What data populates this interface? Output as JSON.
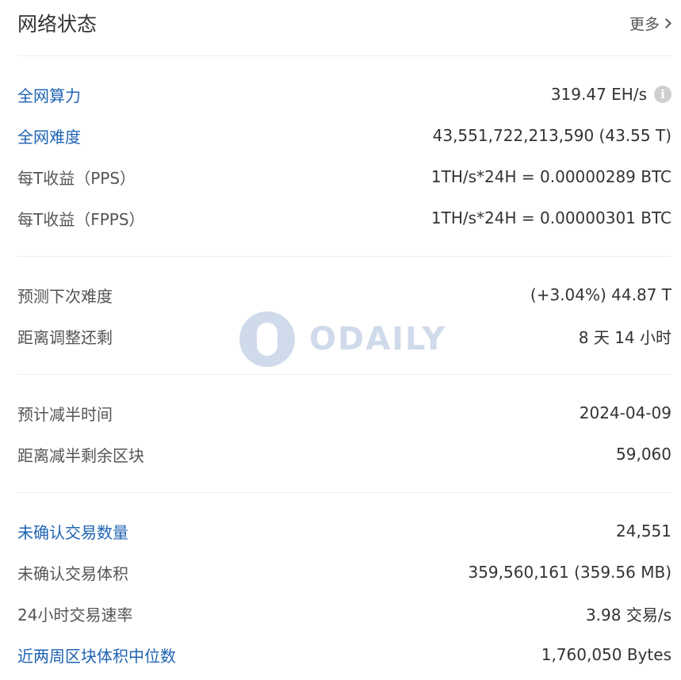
{
  "header": {
    "title": "网络状态",
    "more_label": "更多"
  },
  "sections": [
    {
      "rows": [
        {
          "label": "全网算力",
          "value": "319.47 EH/s",
          "link": true
        },
        {
          "label": "全网难度",
          "value": "43,551,722,213,590 (43.55 T)",
          "link": true
        },
        {
          "label": "每T收益（PPS）",
          "value": "1TH/s*24H = 0.00000289 BTC",
          "link": false
        },
        {
          "label": "每T收益（FPPS）",
          "value": "1TH/s*24H = 0.00000301 BTC",
          "link": false
        }
      ]
    },
    {
      "rows": [
        {
          "label": "预测下次难度",
          "value": "(+3.04%) 44.87 T",
          "link": false
        },
        {
          "label": "距离调整还剩",
          "value": "8 天 14 小时",
          "link": false
        }
      ]
    },
    {
      "rows": [
        {
          "label": "预计减半时间",
          "value": "2024-04-09",
          "link": false
        },
        {
          "label": "距离减半剩余区块",
          "value": "59,060",
          "link": false
        }
      ]
    },
    {
      "rows": [
        {
          "label": "未确认交易数量",
          "value": "24,551",
          "link": true
        },
        {
          "label": "未确认交易体积",
          "value": "359,560,161 (359.56 MB)",
          "link": false
        },
        {
          "label": "24小时交易速率",
          "value": "3.98 交易/s",
          "link": false
        },
        {
          "label": "近两周区块体积中位数",
          "value": "1,760,050 Bytes",
          "link": true
        }
      ]
    }
  ],
  "info_icon_glyph": "i",
  "watermark": {
    "text": "ODAILY",
    "icon": "odaily-logo-icon"
  },
  "colors": {
    "link": "#1f63b3",
    "text": "#333333",
    "divider": "#eeeeee"
  }
}
